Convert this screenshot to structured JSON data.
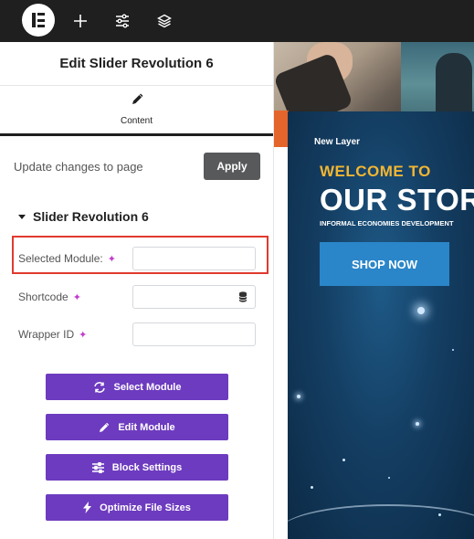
{
  "topbar": {
    "icons": [
      "elementor-logo-icon",
      "plus-icon",
      "sliders-icon",
      "layers-icon"
    ],
    "background": "#1f1f1f"
  },
  "panel": {
    "title": "Edit Slider Revolution 6",
    "tab_label": "Content",
    "update_text": "Update changes to page",
    "apply_label": "Apply",
    "section_title": "Slider Revolution 6",
    "fields": [
      {
        "label": "Selected Module:",
        "value": ""
      },
      {
        "label": "Shortcode",
        "value": ""
      },
      {
        "label": "Wrapper ID",
        "value": ""
      }
    ],
    "buttons": [
      {
        "label": "Select Module",
        "icon": "refresh-icon"
      },
      {
        "label": "Edit Module",
        "icon": "pencil-icon"
      },
      {
        "label": "Block Settings",
        "icon": "sliders-icon"
      },
      {
        "label": "Optimize File Sizes",
        "icon": "bolt-icon"
      }
    ],
    "accent": "#6d3bbf",
    "highlight_color": "#e03a2f"
  },
  "preview": {
    "layer_label": "New Layer",
    "welcome": "WELCOME TO",
    "headline": "OUR STOR",
    "subline": "INFORMAL ECONOMIES DEVELOPMENT",
    "cta": "SHOP NOW",
    "colors": {
      "welcome": "#f2b632",
      "cta": "#2a86c9",
      "background": "#143e63"
    }
  }
}
